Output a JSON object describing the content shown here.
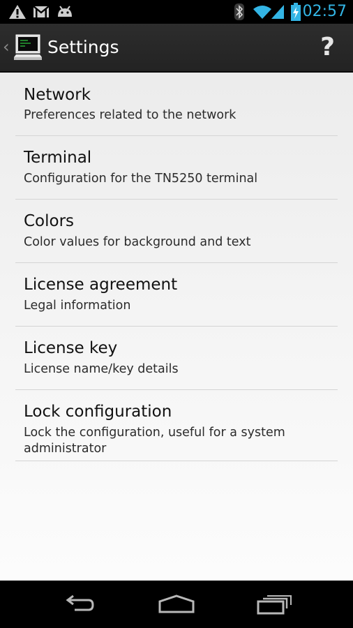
{
  "status_bar": {
    "time": "02:57",
    "icons": [
      "warning-icon",
      "gmail-icon",
      "android-icon",
      "bluetooth-icon",
      "wifi-icon",
      "signal-icon",
      "battery-charging-icon"
    ]
  },
  "action_bar": {
    "title": "Settings",
    "help_label": "?",
    "up_caret": "‹"
  },
  "preferences": [
    {
      "title": "Network",
      "summary": "Preferences related to the network"
    },
    {
      "title": "Terminal",
      "summary": "Configuration for the TN5250 terminal"
    },
    {
      "title": "Colors",
      "summary": "Color values for background and text"
    },
    {
      "title": "License agreement",
      "summary": "Legal information"
    },
    {
      "title": "License key",
      "summary": "License name/key details"
    },
    {
      "title": "Lock configuration",
      "summary": "Lock the configuration, useful for a system administrator"
    }
  ],
  "nav_bar": {
    "buttons": [
      "back-icon",
      "home-icon",
      "recent-apps-icon"
    ]
  },
  "colors": {
    "accent": "#33b5e5",
    "action_bar": "#282828",
    "divider": "#d4d4d4"
  }
}
